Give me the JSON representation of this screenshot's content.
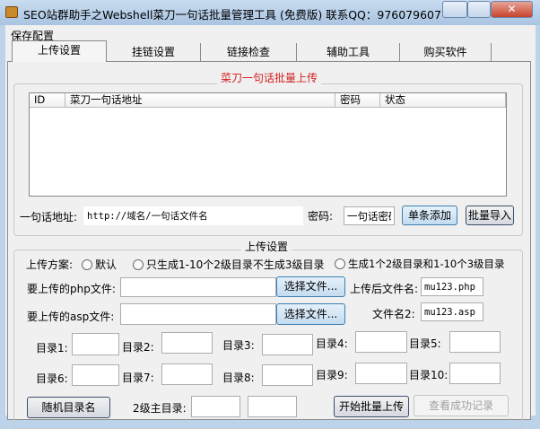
{
  "window": {
    "title": "SEO站群助手之Webshell菜刀一句话批量管理工具  (免费版)  联系QQ：976079607"
  },
  "menu": {
    "save_config": "保存配置"
  },
  "tabs": [
    "上传设置",
    "挂链设置",
    "链接检查",
    "辅助工具",
    "购买软件"
  ],
  "group1": {
    "legend": "菜刀一句话批量上传",
    "columns": [
      "ID",
      "菜刀一句话地址",
      "密码",
      "状态"
    ],
    "url_label": "一句话地址:",
    "url_value": "http://域名/一句话文件名",
    "pwd_label": "密码:",
    "pwd_value": "一句话密码",
    "add_button": "单条添加",
    "import_button": "批量导入"
  },
  "group2": {
    "legend": "上传设置",
    "scheme_label": "上传方案:",
    "scheme_options": [
      "默认",
      "只生成1-10个2级目录不生成3级目录",
      "生成1个2级目录和1-10个3级目录"
    ],
    "php_label": "要上传的php文件:",
    "asp_label": "要上传的asp文件:",
    "choose_file": "选择文件...",
    "upload_name_label": "上传后文件名:",
    "upload_name_value": "mu123.php",
    "name2_label": "文件名2:",
    "name2_value": "mu123.asp",
    "dirs": [
      "目录1:",
      "目录2:",
      "目录3:",
      "目录4:",
      "目录5:",
      "目录6:",
      "目录7:",
      "目录8:",
      "目录9:",
      "目录10:"
    ],
    "random_dir_button": "随机目录名",
    "level2_label": "2级主目录:",
    "start_button": "开始批量上传",
    "view_log_button": "查看成功记录"
  },
  "accent": "#d42020"
}
